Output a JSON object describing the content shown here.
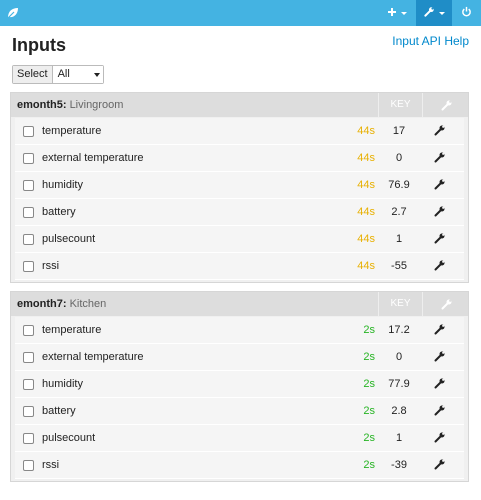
{
  "colors": {
    "topbar": "#44b3e2",
    "active_tab": "#1f8dc7",
    "recent_orange": "#e8b000",
    "recent_green": "#27b424",
    "link": "#0088cc"
  },
  "topbar": {
    "logo_icon": "leaf-icon",
    "add_icon": "plus-icon",
    "tools_icon": "wrench-icon",
    "power_icon": "power-icon"
  },
  "page": {
    "title": "Inputs",
    "help_link": "Input API Help"
  },
  "filter": {
    "label": "Select",
    "selected": "All"
  },
  "nodes": [
    {
      "name": "emonth5:",
      "description": "Livingroom",
      "key_header": "KEY",
      "inputs": [
        {
          "name": "temperature",
          "time": "44s",
          "value": "17"
        },
        {
          "name": "external temperature",
          "time": "44s",
          "value": "0"
        },
        {
          "name": "humidity",
          "time": "44s",
          "value": "76.9"
        },
        {
          "name": "battery",
          "time": "44s",
          "value": "2.7"
        },
        {
          "name": "pulsecount",
          "time": "44s",
          "value": "1"
        },
        {
          "name": "rssi",
          "time": "44s",
          "value": "-55"
        }
      ]
    },
    {
      "name": "emonth7:",
      "description": "Kitchen",
      "key_header": "KEY",
      "inputs": [
        {
          "name": "temperature",
          "time": "2s",
          "value": "17.2"
        },
        {
          "name": "external temperature",
          "time": "2s",
          "value": "0"
        },
        {
          "name": "humidity",
          "time": "2s",
          "value": "77.9"
        },
        {
          "name": "battery",
          "time": "2s",
          "value": "2.8"
        },
        {
          "name": "pulsecount",
          "time": "2s",
          "value": "1"
        },
        {
          "name": "rssi",
          "time": "2s",
          "value": "-39"
        }
      ]
    }
  ]
}
